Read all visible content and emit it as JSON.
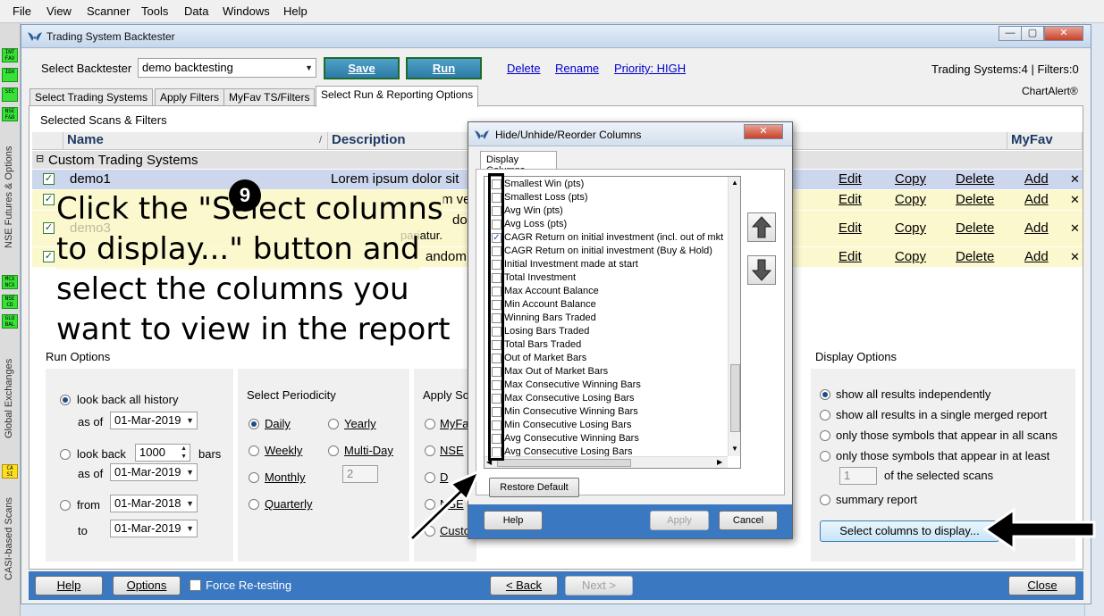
{
  "menubar": {
    "items": [
      "File",
      "View",
      "Scanner",
      "Tools",
      "Data",
      "Windows",
      "Help"
    ]
  },
  "leftstrip": {
    "badges": [
      "INT\nFAV",
      "IDX",
      "SEC",
      "NSE\nF&O",
      "MCX\nNCX",
      "NSE\nCD",
      "GLO\nBAL",
      "CA\nSI"
    ],
    "labels": [
      "NSE Futures & Options",
      "Global Exchanges",
      "CASI-based Scans"
    ]
  },
  "window": {
    "title": "Trading System Backtester",
    "select_backtester_label": "Select Backtester",
    "backtester_value": "demo backtesting",
    "save_label": "Save",
    "run_label": "Run",
    "delete_label": "Delete",
    "rename_label": "Rename",
    "priority_label": "Priority: HIGH",
    "status_text": "Trading Systems:4 | Filters:0",
    "brand_text": "ChartAlert®",
    "tabs": [
      "Select Trading Systems",
      "Apply Filters",
      "MyFav TS/Filters",
      "Select Run & Reporting Options"
    ],
    "selected_scans_title": "Selected Scans & Filters",
    "table": {
      "col_name": "Name",
      "col_desc": "Description",
      "col_myfav": "MyFav",
      "group": "Custom Trading Systems",
      "rows": [
        {
          "name": "demo1",
          "desc": "Lorem ipsum dolor sit"
        },
        {
          "name": "",
          "desc": "m venia"
        },
        {
          "name": "demo3",
          "desc": "dolor in"
        },
        {
          "name": "",
          "desc": "andom de"
        }
      ],
      "row3_desc2": "pariatur.",
      "actions": {
        "edit": "Edit",
        "copy": "Copy",
        "delete": "Delete",
        "add": "Add",
        "remove": "✕"
      }
    },
    "callout": {
      "number": "9",
      "lines": [
        "Click the \"Select columns",
        "to display...\" button and",
        "select the columns you",
        "want to view in the report"
      ]
    },
    "run_options": {
      "title": "Run Options",
      "lookback_all": "look back all history",
      "as_of": "as of",
      "date1": "01-Mar-2019",
      "lookback": "look back",
      "bars_value": "1000",
      "bars": "bars",
      "date2": "01-Mar-2019",
      "from": "from",
      "from_date": "01-Mar-2018",
      "to": "to",
      "to_date": "01-Mar-2019"
    },
    "periodicity": {
      "title": "Select Periodicity",
      "daily": "Daily",
      "yearly": "Yearly",
      "weekly": "Weekly",
      "multiday": "Multi-Day",
      "monthly": "Monthly",
      "multiday_value": "2",
      "quarterly": "Quarterly"
    },
    "apply_scans": {
      "title": "Apply Sc",
      "opt1": "MyFa",
      "opt2": "NSE",
      "opt3": "D",
      "opt4": "NSE",
      "opt5": "Custo"
    },
    "display_options": {
      "title": "Display Options",
      "opt1": "show all results independently",
      "opt2": "show all results in a single merged report",
      "opt3": "only those symbols that appear in all scans",
      "opt4": "only those symbols that appear in at least",
      "spinner_value": "1",
      "of_selected": "of the selected scans",
      "opt5": "summary report",
      "select_columns": "Select columns to display..."
    },
    "bottom": {
      "help": "Help",
      "options": "Options",
      "force": "Force Re-testing",
      "back": "< Back",
      "next": "Next >",
      "close": "Close"
    }
  },
  "dialog": {
    "title": "Hide/Unhide/Reorder Columns",
    "tab": "Display Columns",
    "columns": [
      {
        "label": "Smallest Win (pts)",
        "checked": false
      },
      {
        "label": "Smallest Loss (pts)",
        "checked": false
      },
      {
        "label": "Avg Win (pts)",
        "checked": false
      },
      {
        "label": "Avg Loss (pts)",
        "checked": false
      },
      {
        "label": "CAGR Return on initial investment (incl. out of mkt",
        "checked": true
      },
      {
        "label": "CAGR Return on initial investment (Buy & Hold)",
        "checked": false
      },
      {
        "label": "Initial Investment made at start",
        "checked": false
      },
      {
        "label": "Total Investment",
        "checked": false
      },
      {
        "label": "Max Account Balance",
        "checked": false
      },
      {
        "label": "Min Account Balance",
        "checked": false
      },
      {
        "label": "Winning Bars Traded",
        "checked": false
      },
      {
        "label": "Losing Bars Traded",
        "checked": false
      },
      {
        "label": "Total Bars Traded",
        "checked": false
      },
      {
        "label": "Out of Market Bars",
        "checked": false
      },
      {
        "label": "Max Out of Market Bars",
        "checked": false
      },
      {
        "label": "Max Consecutive Winning Bars",
        "checked": false
      },
      {
        "label": "Max Consecutive Losing Bars",
        "checked": false
      },
      {
        "label": "Min Consecutive Winning Bars",
        "checked": false
      },
      {
        "label": "Min Consecutive Losing Bars",
        "checked": false
      },
      {
        "label": "Avg Consecutive Winning Bars",
        "checked": false
      },
      {
        "label": "Avg Consecutive Losing Bars",
        "checked": false
      }
    ],
    "restore_default": "Restore Default",
    "help": "Help",
    "apply": "Apply",
    "cancel": "Cancel"
  }
}
